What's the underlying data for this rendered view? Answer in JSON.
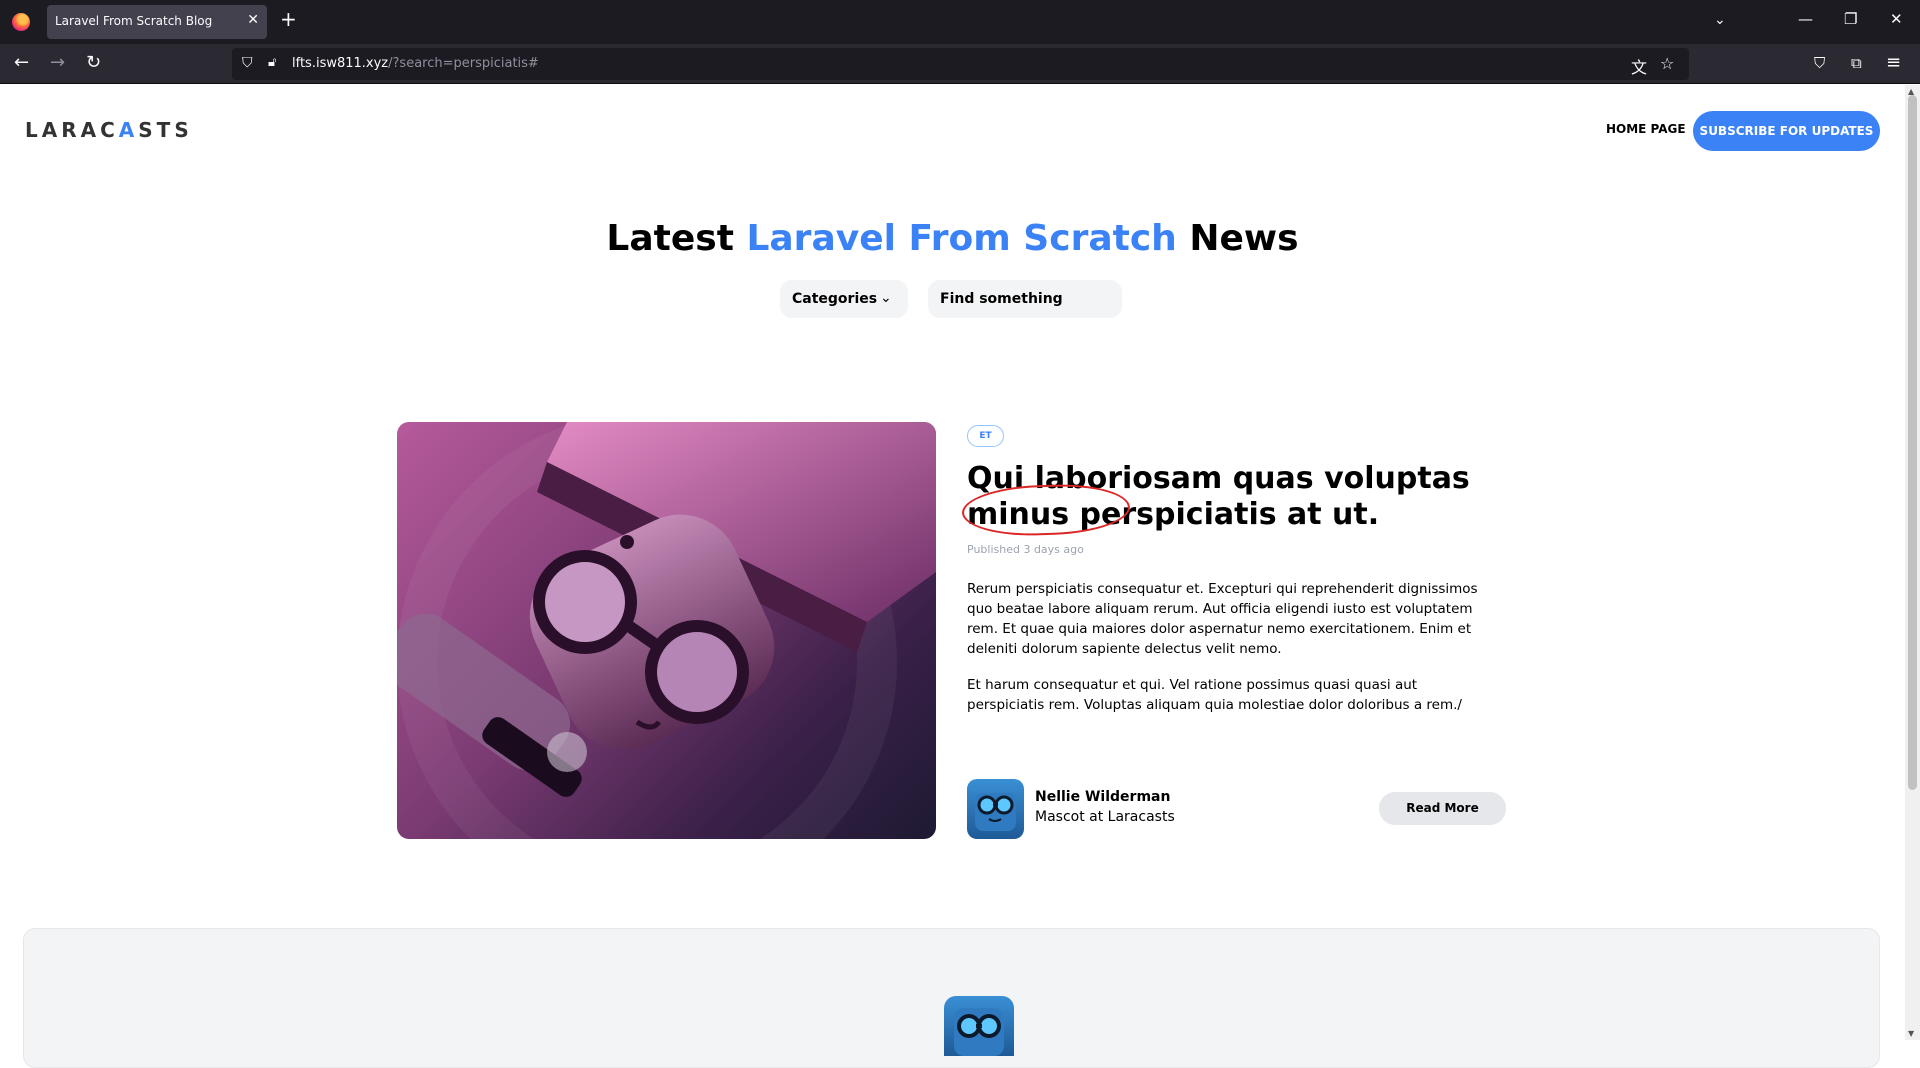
{
  "browser": {
    "tab_title": "Laravel From Scratch Blog",
    "url_host": "lfts.isw811.xyz",
    "url_rest": "/?search=perspiciatis#"
  },
  "site": {
    "logo_text_a": "LARAC",
    "logo_text_b": "STS",
    "logo_accent": "A",
    "nav": {
      "home": "HOME PAGE",
      "subscribe": "SUBSCRIBE FOR UPDATES"
    },
    "hero": {
      "title_prefix": "Latest ",
      "title_accent": "Laravel From Scratch",
      "title_suffix": " News"
    },
    "filters": {
      "categories_label": "Categories",
      "search_placeholder": "Find something"
    },
    "accent_color": "#3b82f6"
  },
  "post": {
    "category": "ET",
    "title": "Qui laboriosam quas voluptas minus perspiciatis at ut.",
    "published": "Published 3 days ago",
    "paragraphs": [
      "Rerum perspiciatis consequatur et. Excepturi qui reprehenderit dignissimos quo beatae labore aliquam rerum. Aut officia eligendi iusto est voluptatem rem. Et quae quia maiores dolor aspernatur nemo exercitationem. Enim et deleniti dolorum sapiente delectus velit nemo.",
      "Et harum consequatur et qui. Vel ratione possimus quasi quasi aut perspiciatis rem. Voluptas aliquam quia molestiae dolor doloribus a rem./"
    ],
    "author": {
      "name": "Nellie Wilderman",
      "role": "Mascot at Laracasts"
    },
    "read_more": "Read More"
  }
}
